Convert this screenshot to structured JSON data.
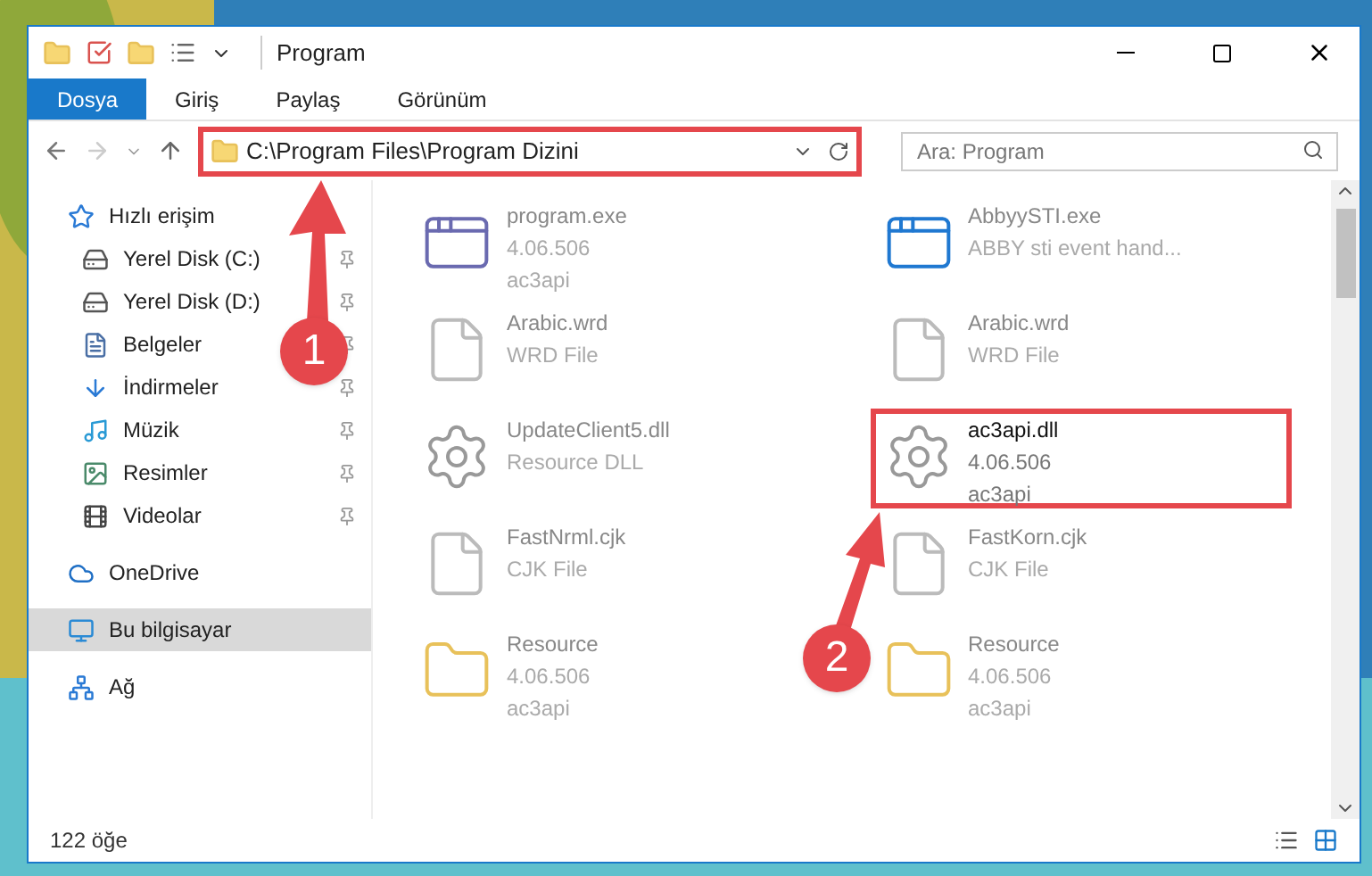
{
  "window": {
    "title": "Program"
  },
  "ribbon_tabs": [
    {
      "label": "Dosya",
      "selected": true
    },
    {
      "label": "Giriş",
      "selected": false
    },
    {
      "label": "Paylaş",
      "selected": false
    },
    {
      "label": "Görünüm",
      "selected": false
    }
  ],
  "address": {
    "path": "C:\\Program Files\\Program Dizini",
    "highlighted": true
  },
  "search": {
    "placeholder": "Ara: Program"
  },
  "sidebar": {
    "items": [
      {
        "label": "Hızlı erişim",
        "kind": "star",
        "pinned": false,
        "selected": false,
        "children": [
          {
            "label": "Yerel Disk (C:)",
            "kind": "drive",
            "pinned": true,
            "selected": false
          },
          {
            "label": "Yerel Disk (D:)",
            "kind": "drive",
            "pinned": true,
            "selected": false
          },
          {
            "label": "Belgeler",
            "kind": "documents",
            "pinned": true,
            "selected": false
          },
          {
            "label": "İndirmeler",
            "kind": "downloads",
            "pinned": true,
            "selected": false
          },
          {
            "label": "Müzik",
            "kind": "music",
            "pinned": true,
            "selected": false
          },
          {
            "label": "Resimler",
            "kind": "pictures",
            "pinned": true,
            "selected": false
          },
          {
            "label": "Videolar",
            "kind": "videos",
            "pinned": true,
            "selected": false
          }
        ]
      },
      {
        "label": "OneDrive",
        "kind": "cloud",
        "pinned": false,
        "selected": false
      },
      {
        "label": "Bu bilgisayar",
        "kind": "computer",
        "pinned": false,
        "selected": true
      },
      {
        "label": "Ağ",
        "kind": "network",
        "pinned": false,
        "selected": false
      }
    ]
  },
  "files": [
    {
      "name": "program.exe",
      "lines": [
        "4.06.506",
        "ac3api"
      ],
      "kind": "app",
      "highlighted": false
    },
    {
      "name": "AbbyySTI.exe",
      "lines": [
        "ABBY sti event hand..."
      ],
      "kind": "window",
      "highlighted": false
    },
    {
      "name": "Arabic.wrd",
      "lines": [
        "WRD File"
      ],
      "kind": "document",
      "highlighted": false
    },
    {
      "name": "Arabic.wrd",
      "lines": [
        "WRD File"
      ],
      "kind": "document",
      "highlighted": false
    },
    {
      "name": "UpdateClient5.dll",
      "lines": [
        "Resource DLL"
      ],
      "kind": "settings",
      "highlighted": false
    },
    {
      "name": "ac3api.dll",
      "lines": [
        "4.06.506",
        "ac3api"
      ],
      "kind": "settings",
      "highlighted": true
    },
    {
      "name": "FastNrml.cjk",
      "lines": [
        "CJK File"
      ],
      "kind": "document",
      "highlighted": false
    },
    {
      "name": "FastKorn.cjk",
      "lines": [
        "CJK File"
      ],
      "kind": "document",
      "highlighted": false
    },
    {
      "name": "Resource",
      "lines": [
        "4.06.506",
        "ac3api"
      ],
      "kind": "folder",
      "highlighted": false
    },
    {
      "name": "Resource",
      "lines": [
        "4.06.506",
        "ac3api"
      ],
      "kind": "folder",
      "highlighted": false
    }
  ],
  "status_bar": {
    "count": "122 öğe"
  },
  "callouts": [
    {
      "number": "1"
    },
    {
      "number": "2"
    }
  ]
}
